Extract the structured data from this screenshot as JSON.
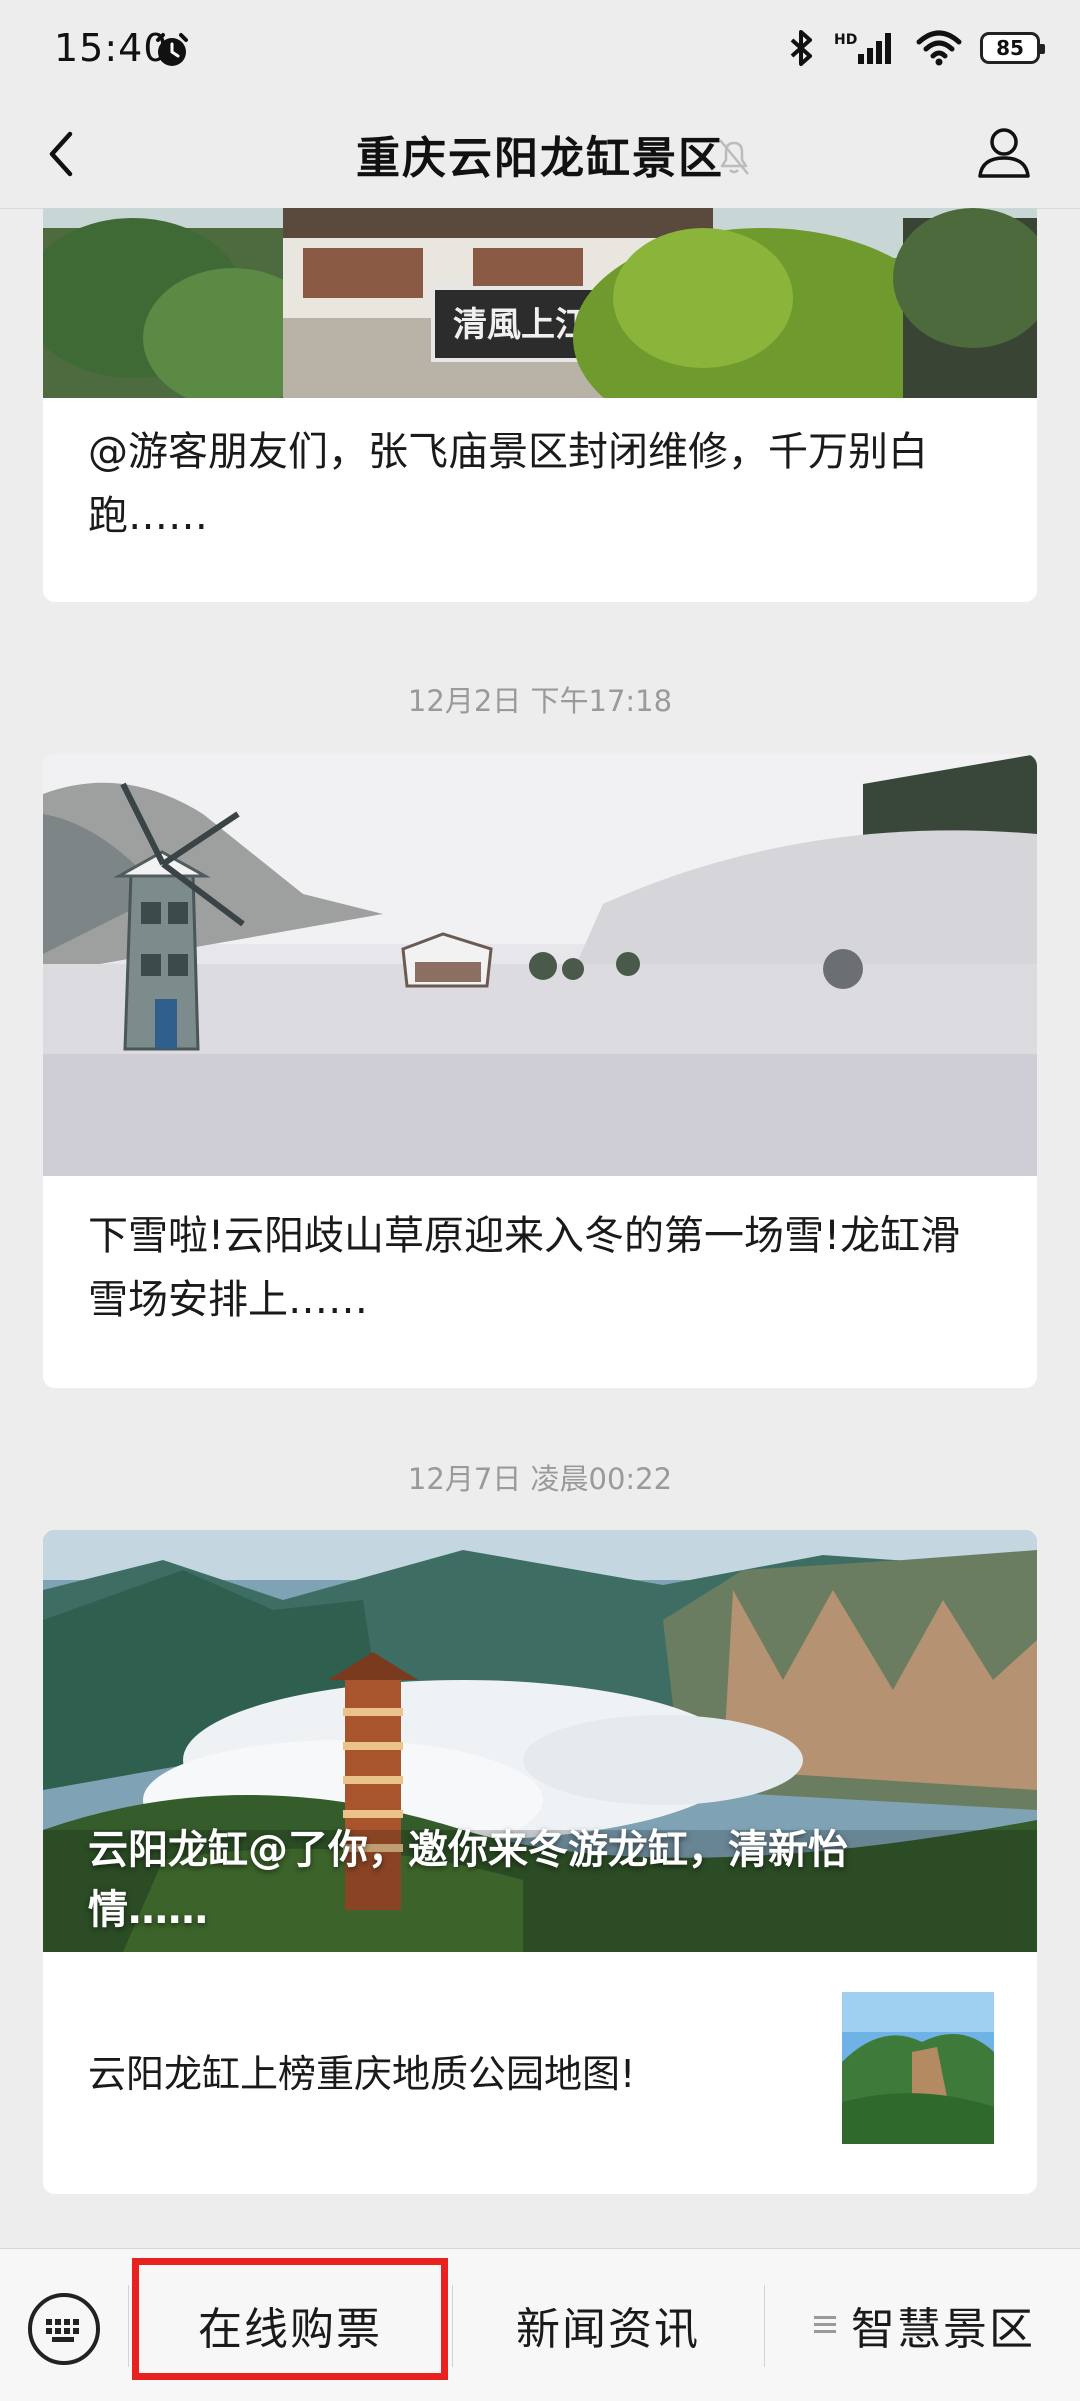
{
  "status_bar": {
    "time": "15:40",
    "battery": "85",
    "network": "HD"
  },
  "nav": {
    "title": "重庆云阳龙缸景区"
  },
  "feed": {
    "card1": {
      "image_sign": "清風上江",
      "title": "@游客朋友们，张飞庙景区封闭维修，千万别白跑……"
    },
    "timestamp2": "12月2日 下午17:18",
    "card2": {
      "title": "下雪啦!云阳歧山草原迎来入冬的第一场雪!龙缸滑雪场安排上……"
    },
    "timestamp3": "12月7日 凌晨00:22",
    "card3": {
      "title": "云阳龙缸@了你，邀你来冬游龙缸，清新怡情……",
      "sub_item": "云阳龙缸上榜重庆地质公园地图!"
    }
  },
  "bottom_menu": {
    "items": [
      "在线购票",
      "新闻资讯",
      "智慧景区"
    ],
    "highlight_color": "#e8231f"
  }
}
